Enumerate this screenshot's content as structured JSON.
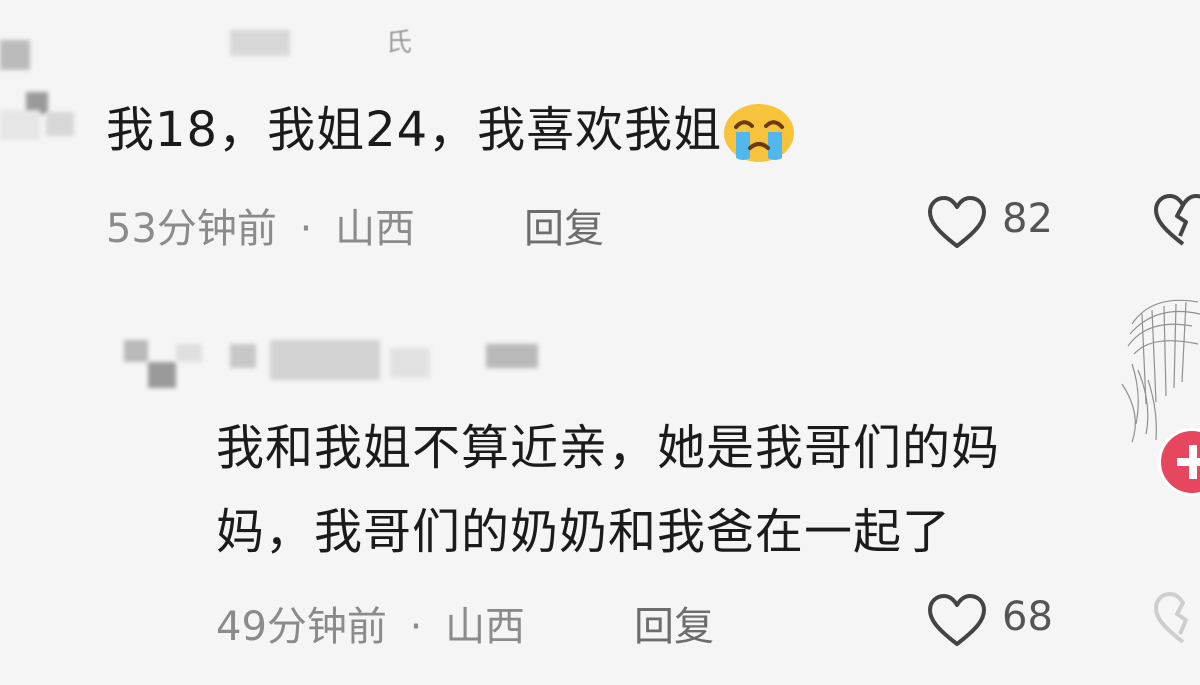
{
  "comment1": {
    "username": "氏",
    "text": "我18，我姐24，我喜欢我姐",
    "emoji": "crying-face",
    "time": "53分钟前",
    "location": "山西",
    "reply_label": "回复",
    "likes": "82"
  },
  "comment2": {
    "text_line1": "我和我姐不算近亲，她是我哥们的妈",
    "text_line2": "妈，我哥们的奶奶和我爸在一起了",
    "time": "49分钟前",
    "location": "山西",
    "reply_label": "回复",
    "likes": "68"
  },
  "separator": "·",
  "colors": {
    "background": "#f5f5f5",
    "text": "#1b1b1b",
    "meta": "#8b8b8b",
    "follow_badge": "#e7475e"
  },
  "icons": [
    "heart-icon",
    "dislike-icon",
    "crying-emoji-icon",
    "follow-badge-icon"
  ]
}
